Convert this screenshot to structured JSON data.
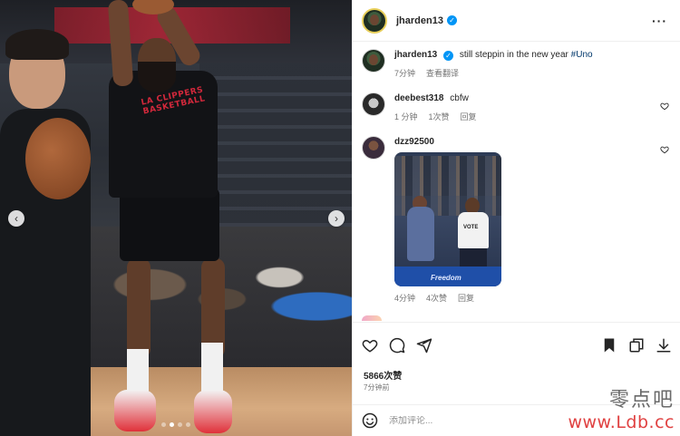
{
  "post": {
    "author": "jharden13",
    "caption_author": "jharden13",
    "caption_text": "still steppin in the new year",
    "hashtag": "#Uno",
    "caption_time": "7分钟",
    "caption_translate": "查看翻译",
    "jersey_text": "LA CLIPPERS BASKETBALL"
  },
  "carousel": {
    "prev_icon": "‹",
    "next_icon": "›",
    "slide_count": 4,
    "active_slide": 1
  },
  "comments": [
    {
      "user": "deebest318",
      "text": "cbfw",
      "time": "1 分钟",
      "likes": "1次赞",
      "reply": "回复"
    },
    {
      "user": "dzz92500",
      "text": "",
      "image_court_text": "Freedom",
      "image_shirt_text": "VOTE",
      "time": "4分钟",
      "likes": "4次赞",
      "reply": "回复"
    }
  ],
  "stats": {
    "likes": "5866次赞",
    "time": "7分钟前"
  },
  "comment_box": {
    "placeholder": "添加评论..."
  },
  "icons": {
    "more": "more-options-icon",
    "verified": "verified-badge-icon",
    "like": "heart-icon",
    "comment": "comment-icon",
    "share": "send-icon",
    "save": "bookmark-icon",
    "repost": "repost-icon",
    "download": "download-icon",
    "emoji": "emoji-icon"
  },
  "watermark": {
    "chinese": "零点吧",
    "url": "www.Ldb.cc"
  },
  "colors": {
    "verified_blue": "#0095f6",
    "hashtag": "#00376b",
    "watermark_red": "#e04141"
  }
}
